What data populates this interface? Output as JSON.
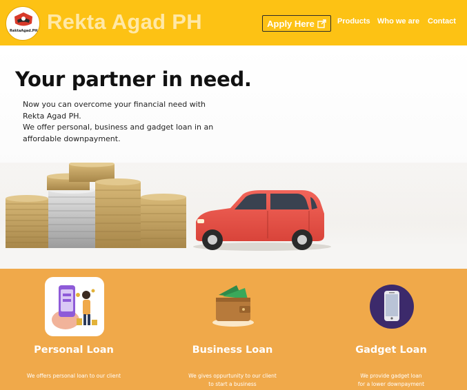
{
  "header": {
    "logo_text": "RektaAgad.PH",
    "brand": "Rekta Agad PH",
    "apply_label": "Apply Here",
    "nav": [
      "Products",
      "Who we are",
      "Contact"
    ]
  },
  "hero": {
    "title": "Your partner in need.",
    "description_lines": [
      "Now you can overcome your financial need with",
      "Rekta Agad PH.",
      "We offer personal, business and gadget loan in an",
      "affordable downpayment."
    ]
  },
  "products": [
    {
      "title": "Personal Loan",
      "icon": "personal-loan-icon",
      "desc_lines": [
        "We offers personal loan to our client"
      ]
    },
    {
      "title": "Business Loan",
      "icon": "wallet-icon",
      "desc_lines": [
        "We gives oppurtunity to our client",
        "to start a business"
      ]
    },
    {
      "title": "Gadget Loan",
      "icon": "smartphone-icon",
      "desc_lines": [
        "We provide gadget loan",
        "for a lower downpayment"
      ]
    }
  ],
  "colors": {
    "header_bg": "#fdc214",
    "brand_text": "#ffe8a6",
    "band_bg": "#f0a94a"
  }
}
